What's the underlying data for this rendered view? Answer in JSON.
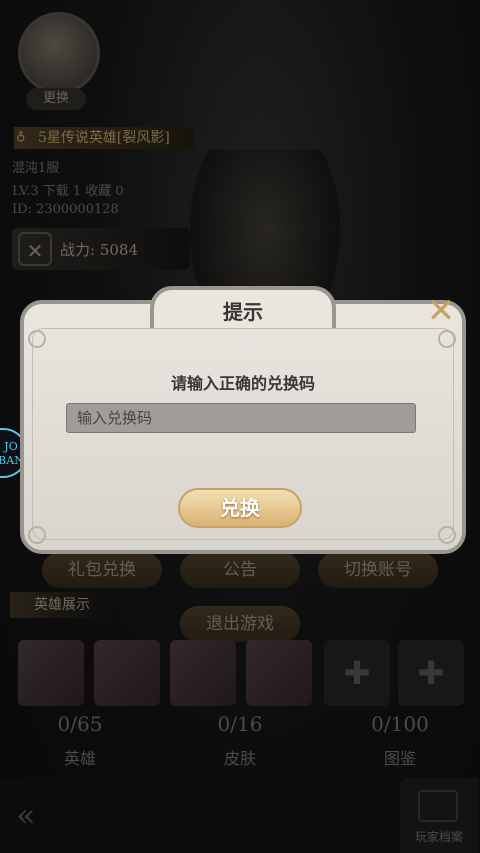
{
  "profile": {
    "change_label": "更换",
    "title_label": "5星传说英雄[裂风影]",
    "name": "混沌1服",
    "level_line": "LV.3   下载   1   收藏   0",
    "id_line": "ID: 2300000128",
    "power_label": "战力: 5084"
  },
  "menu": {
    "gift_redeem": "礼包兑换",
    "notice": "公告",
    "switch_account": "切换账号",
    "exit_game": "退出游戏"
  },
  "showcase": {
    "header": "英雄展示"
  },
  "stats": [
    {
      "count": "0/65",
      "label": "英雄"
    },
    {
      "count": "0/16",
      "label": "皮肤"
    },
    {
      "count": "0/100",
      "label": "图鉴"
    }
  ],
  "footer": {
    "archive_label": "玩家档案"
  },
  "side_badge": "JO\nBAN",
  "dialog": {
    "title": "提示",
    "message": "请输入正确的兑换码",
    "input_placeholder": "输入兑换码",
    "input_value": "",
    "redeem_label": "兑换",
    "close_icon": "close-icon"
  },
  "colors": {
    "accent_gold": "#c7a265",
    "dialog_bg": "#e9e6e0",
    "badge_cyan": "#59c8e6"
  }
}
